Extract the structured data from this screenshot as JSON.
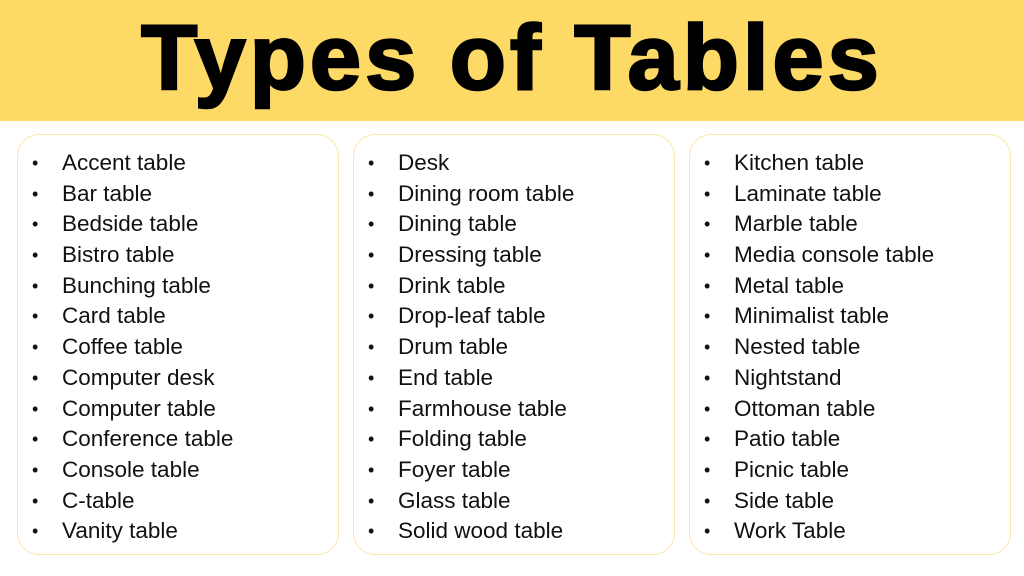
{
  "header": {
    "title": "Types of Tables"
  },
  "colors": {
    "header_bg": "#fdd966",
    "box_border": "#fde7a4"
  },
  "columns": [
    {
      "items": [
        "Accent table",
        "Bar table",
        "Bedside table",
        "Bistro table",
        "Bunching table",
        "Card table",
        "Coffee table",
        "Computer desk",
        "Computer table",
        "Conference table",
        "Console table",
        "C-table",
        "Vanity table"
      ]
    },
    {
      "items": [
        "Desk",
        "Dining room table",
        "Dining table",
        "Dressing table",
        "Drink table",
        "Drop-leaf table",
        "Drum table",
        "End table",
        "Farmhouse table",
        "Folding table",
        "Foyer table",
        "Glass table",
        "Solid wood table"
      ]
    },
    {
      "items": [
        "Kitchen table",
        "Laminate table",
        "Marble table",
        "Media console table",
        "Metal table",
        "Minimalist table",
        "Nested table",
        "Nightstand",
        "Ottoman table",
        "Patio table",
        "Picnic table",
        "Side table",
        "Work Table"
      ]
    }
  ],
  "bullet_glyph": "•"
}
